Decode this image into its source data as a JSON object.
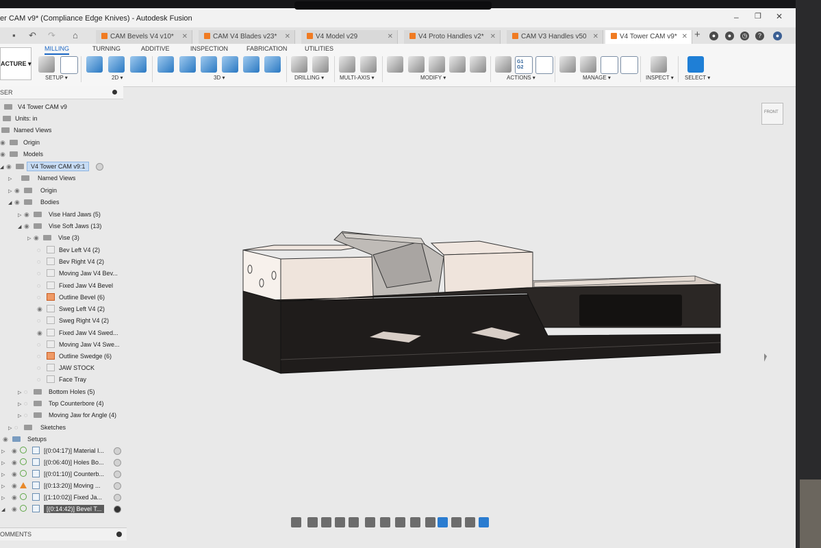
{
  "app": {
    "title": "er CAM v9* (Compliance Edge Knives) - Autodesk Fusion"
  },
  "doc_tabs": [
    {
      "label": "CAM Bevels V4 v10*"
    },
    {
      "label": "CAM V4 Blades v23*"
    },
    {
      "label": "V4 Model v29"
    },
    {
      "label": "V4 Proto Handles v2*"
    },
    {
      "label": "CAM V3 Handles v50"
    },
    {
      "label": "V4 Tower CAM v9*"
    }
  ],
  "workspace": {
    "label": "ACTURE"
  },
  "ribbon": {
    "tabs": [
      "MILLING",
      "TURNING",
      "ADDITIVE",
      "INSPECTION",
      "FABRICATION",
      "UTILITIES"
    ],
    "active_tab": "MILLING",
    "groups": [
      "SETUP",
      "2D",
      "3D",
      "DRILLING",
      "MULTI-AXIS",
      "MODIFY",
      "ACTIONS",
      "MANAGE",
      "INSPECT",
      "SELECT"
    ],
    "actions_icon_text": "G1 G2"
  },
  "browser": {
    "header": "SER",
    "root": "V4 Tower CAM v9",
    "units": "Units: in",
    "named_views": "Named Views",
    "origin": "Origin",
    "models": "Models",
    "component": "V4 Tower CAM v9:1",
    "comp_named_views": "Named Views",
    "comp_origin": "Origin",
    "bodies": "Bodies",
    "vise_hard_jaws": "Vise Hard Jaws (5)",
    "vise_soft_jaws": "Vise Soft Jaws (13)",
    "vise": "Vise (3)",
    "soft_jaw_bodies": [
      "Bev Left V4 (2)",
      "Bev Right V4 (2)",
      "Moving Jaw V4 Bev...",
      "Fixed Jaw V4 Bevel",
      "Outline Bevel (6)",
      "Sweg Left V4 (2)",
      "Sweg Right V4 (2)",
      "Fixed Jaw V4 Swed...",
      "Moving Jaw V4 Swe...",
      "Outline Swedge (6)",
      "JAW STOCK",
      "Face Tray"
    ],
    "bottom_holes": "Bottom Holes (5)",
    "top_counterbore": "Top Counterbore (4)",
    "moving_jaw_angle": "Moving Jaw for Angle (4)",
    "sketches": "Sketches",
    "setups": "Setups",
    "setup_items": [
      "[(0:04:17)] Material I...",
      "[(0:06:40)] Holes Bo...",
      "[(0:01:10)] Counterb...",
      "[(0:13:20)] Moving ...",
      "[(1:10:02)] Fixed Ja...",
      "[(0:14:42)] Bevel T..."
    ]
  },
  "comments": {
    "label": "OMMENTS"
  },
  "viewcube": {
    "label": "FRONT"
  }
}
